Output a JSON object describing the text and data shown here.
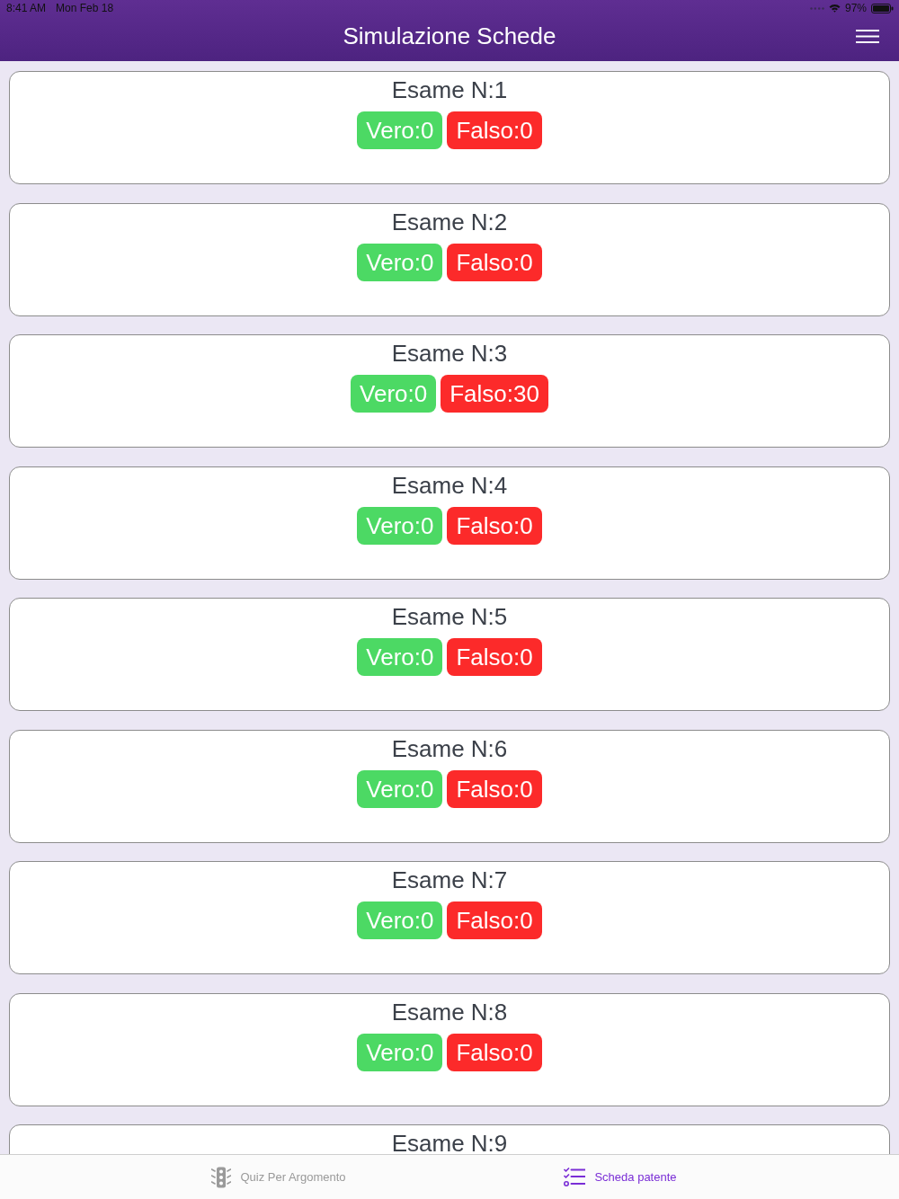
{
  "status_bar": {
    "time": "8:41 AM",
    "date": "Mon Feb 18",
    "battery": "97%"
  },
  "header": {
    "title": "Simulazione Schede"
  },
  "exams": [
    {
      "title": "Esame N:1",
      "badges": [
        {
          "kind": "correct",
          "label": "Vero:0"
        },
        {
          "kind": "wrong",
          "label": "Falso:0"
        }
      ]
    },
    {
      "title": "Esame N:2",
      "badges": [
        {
          "kind": "correct",
          "label": "Vero:0"
        },
        {
          "kind": "wrong",
          "label": "Falso:0"
        }
      ]
    },
    {
      "title": "Esame N:3",
      "badges": [
        {
          "kind": "correct",
          "label": "Vero:0"
        },
        {
          "kind": "wrong",
          "label": "Falso:30"
        }
      ]
    },
    {
      "title": "Esame N:4",
      "badges": [
        {
          "kind": "correct",
          "label": "Vero:0"
        },
        {
          "kind": "wrong",
          "label": "Falso:0"
        }
      ]
    },
    {
      "title": "Esame N:5",
      "badges": [
        {
          "kind": "correct",
          "label": "Vero:0"
        },
        {
          "kind": "wrong",
          "label": "Falso:0"
        }
      ]
    },
    {
      "title": "Esame N:6",
      "badges": [
        {
          "kind": "correct",
          "label": "Vero:0"
        },
        {
          "kind": "wrong",
          "label": "Falso:0"
        }
      ]
    },
    {
      "title": "Esame N:7",
      "badges": [
        {
          "kind": "correct",
          "label": "Vero:0"
        },
        {
          "kind": "wrong",
          "label": "Falso:0"
        }
      ]
    },
    {
      "title": "Esame N:8",
      "badges": [
        {
          "kind": "correct",
          "label": "Vero:0"
        },
        {
          "kind": "wrong",
          "label": "Falso:0"
        }
      ]
    },
    {
      "title": "Esame N:9"
    }
  ],
  "tab_bar": [
    {
      "kind": "traffic-light",
      "label": "Quiz Per Argomento",
      "selected": false
    },
    {
      "kind": "checklist",
      "label": "Scheda patente",
      "selected": true
    }
  ]
}
